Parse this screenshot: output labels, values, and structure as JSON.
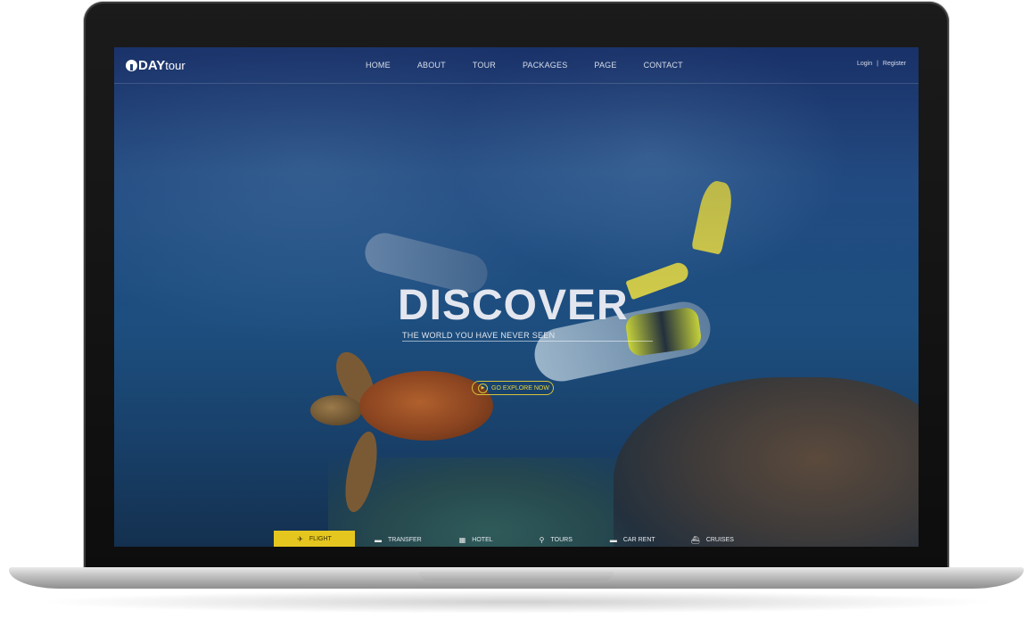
{
  "brand": {
    "logo_bold": "DAY",
    "logo_light": "tour"
  },
  "nav": {
    "items": [
      "HOME",
      "ABOUT",
      "TOUR",
      "PACKAGES",
      "PAGE",
      "CONTACT"
    ]
  },
  "auth": {
    "login": "Login",
    "separator": "|",
    "register": "Register"
  },
  "hero": {
    "title": "DISCOVER",
    "subtitle": "THE WORLD YOU HAVE NEVER SEEN",
    "cta": "GO EXPLORE NOW"
  },
  "booking_tabs": {
    "items": [
      {
        "label": "FLIGHT",
        "icon": "plane-icon",
        "active": true
      },
      {
        "label": "TRANSFER",
        "icon": "car-icon",
        "active": false
      },
      {
        "label": "HOTEL",
        "icon": "hotel-icon",
        "active": false
      },
      {
        "label": "TOURS",
        "icon": "hiker-icon",
        "active": false
      },
      {
        "label": "CAR RENT",
        "icon": "car-rent-icon",
        "active": false
      },
      {
        "label": "CRUISES",
        "icon": "ship-icon",
        "active": false
      }
    ]
  },
  "colors": {
    "accent_yellow": "#e5c61f",
    "nav_text": "#d8deea",
    "hero_overlay": "#1b3a7a"
  }
}
